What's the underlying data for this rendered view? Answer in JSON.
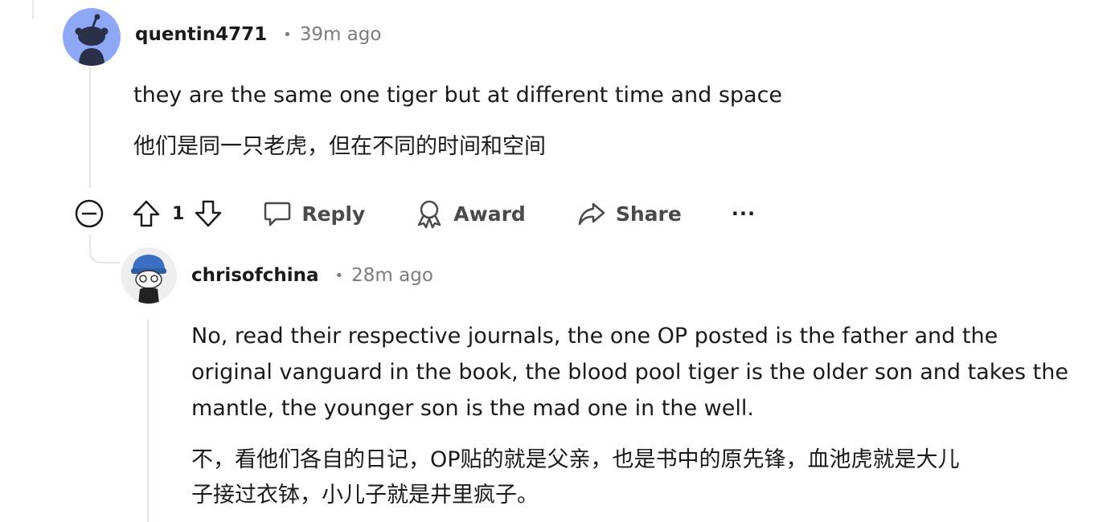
{
  "comment1": {
    "username": "quentin4771",
    "separator": "•",
    "time": "39m ago",
    "body_en": "they are the same one tiger but at different time and space",
    "body_cn": "他们是同一只老虎，但在不同的时间和空间"
  },
  "actions": {
    "upvote_count": "1",
    "reply_label": "Reply",
    "award_label": "Award",
    "share_label": "Share",
    "more_label": "···"
  },
  "comment2": {
    "username": "chrisofchina",
    "separator": "•",
    "time": "28m ago",
    "body_en_lines": [
      "No, read their respective journals, the one OP posted is the father and the",
      "original vanguard in the book, the blood pool tiger is the older son and takes the",
      "mantle, the younger son is the mad one in the well."
    ],
    "body_cn_lines": [
      "不，看他们各自的日记，OP贴的就是父亲，也是书中的原先锋，血池虎就是大儿",
      "子接过衣钵，小儿子就是井里疯子。"
    ]
  },
  "colors": {
    "avatar1_bg": "#8fa8f5",
    "avatar2_bg": "#eeeeee",
    "meta_gray": "#7c7c7c",
    "thread_line": "#e5e5e5"
  }
}
